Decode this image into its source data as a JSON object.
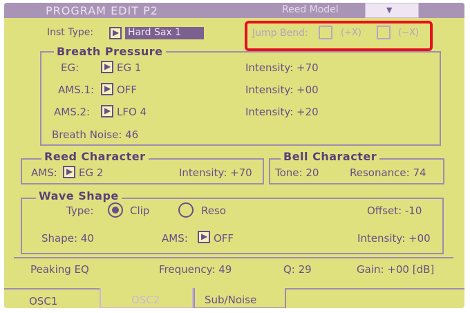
{
  "header": {
    "title": "PROGRAM EDIT P2",
    "model": "Reed Model",
    "menu_icon": "chevron-down-icon"
  },
  "inst_type": {
    "label": "Inst Type:",
    "value": "Hard Sax 1"
  },
  "jump_bend": {
    "label": "Jump Bend:",
    "pos_label": "(+X)",
    "neg_label": "(−X)"
  },
  "breath_pressure": {
    "title": "Breath Pressure",
    "eg": {
      "label": "EG:",
      "value": "EG 1",
      "intensity": "Intensity: +70"
    },
    "ams1": {
      "label": "AMS.1:",
      "value": "OFF",
      "intensity": "Intensity: +00"
    },
    "ams2": {
      "label": "AMS.2:",
      "value": "LFO 4",
      "intensity": "Intensity: +20"
    },
    "noise": "Breath Noise: 46"
  },
  "reed_character": {
    "title": "Reed Character",
    "ams_label": "AMS:",
    "ams_value": "EG 2",
    "intensity": "Intensity: +70"
  },
  "bell_character": {
    "title": "Bell Character",
    "tone": "Tone: 20",
    "resonance": "Resonance: 74"
  },
  "wave_shape": {
    "title": "Wave Shape",
    "type_label": "Type:",
    "options": [
      "Clip",
      "Reso"
    ],
    "selected": "Clip",
    "offset": "Offset: -10",
    "shape": "Shape: 40",
    "ams_label": "AMS:",
    "ams_value": "OFF",
    "intensity": "Intensity: +00"
  },
  "peaking_eq": {
    "label": "Peaking EQ",
    "frequency": "Frequency: 49",
    "q": "Q: 29",
    "gain": "Gain: +00 [dB]"
  },
  "tabs": [
    "OSC1",
    "OSC2",
    "Sub/Noise"
  ],
  "colors": {
    "screen": "#dfe17f",
    "ink": "#6a4e86",
    "highlight": "#e5121c"
  }
}
